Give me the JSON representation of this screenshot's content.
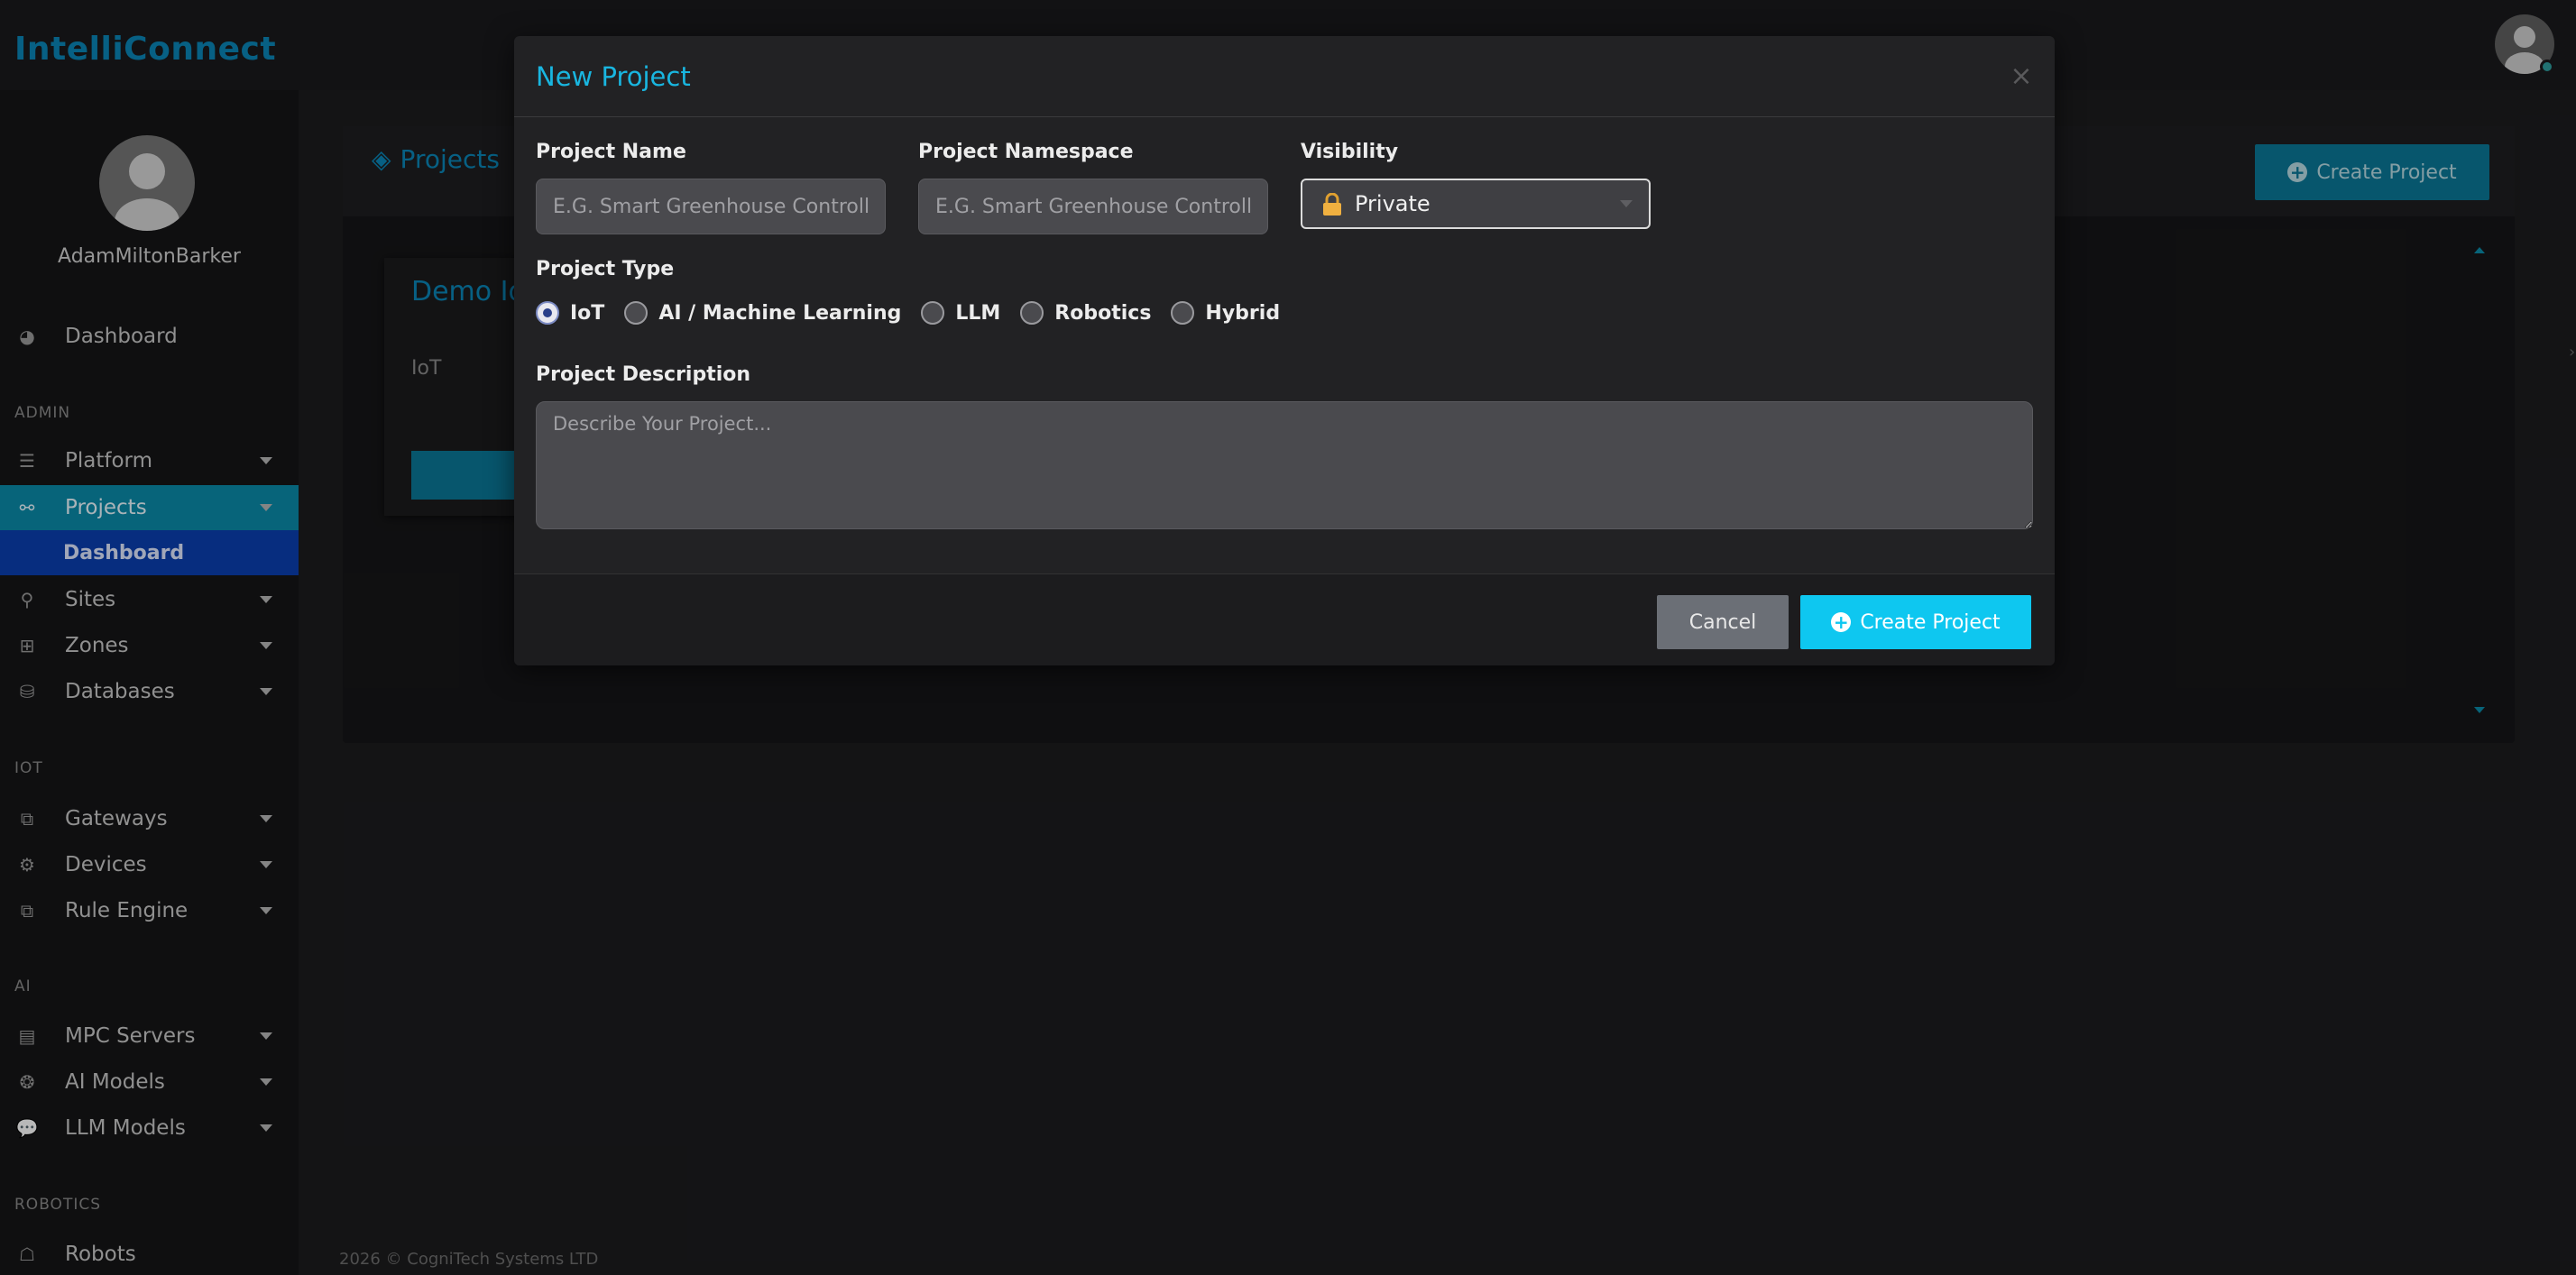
{
  "app": {
    "brand": "IntelliConnect"
  },
  "sidebar": {
    "user_name": "AdamMiltonBarker",
    "dashboard": "Dashboard",
    "sections": {
      "admin": "ADMIN",
      "iot": "IOT",
      "ai": "AI",
      "robotics": "ROBOTICS"
    },
    "items": {
      "platform": "Platform",
      "projects": "Projects",
      "projects_dashboard": "Dashboard",
      "sites": "Sites",
      "zones": "Zones",
      "databases": "Databases",
      "gateways": "Gateways",
      "devices": "Devices",
      "rule_engine": "Rule Engine",
      "mpc_servers": "MPC Servers",
      "ai_models": "AI Models",
      "llm_models": "LLM Models",
      "robots": "Robots"
    }
  },
  "main": {
    "title": "Projects",
    "create_button": "Create Project",
    "demo_card": {
      "title": "Demo Io",
      "type": "IoT"
    }
  },
  "footer": {
    "text": "2026 © CogniTech Systems LTD"
  },
  "modal": {
    "title": "New Project",
    "project_name": {
      "label": "Project Name",
      "placeholder": "E.G. Smart Greenhouse Controller"
    },
    "project_namespace": {
      "label": "Project Namespace",
      "placeholder": "E.G. Smart Greenhouse Controller"
    },
    "visibility": {
      "label": "Visibility",
      "value": "Private"
    },
    "project_type": {
      "label": "Project Type",
      "options": [
        "IoT",
        "AI / Machine Learning",
        "LLM",
        "Robotics",
        "Hybrid"
      ],
      "selected": "IoT"
    },
    "description": {
      "label": "Project Description",
      "placeholder": "Describe Your Project..."
    },
    "cancel": "Cancel",
    "create": "Create Project"
  },
  "colors": {
    "accent": "#0ec7f0",
    "brand": "#0a86b8",
    "active_nav": "#0b8baa",
    "sub_nav": "#0a3fb0"
  }
}
